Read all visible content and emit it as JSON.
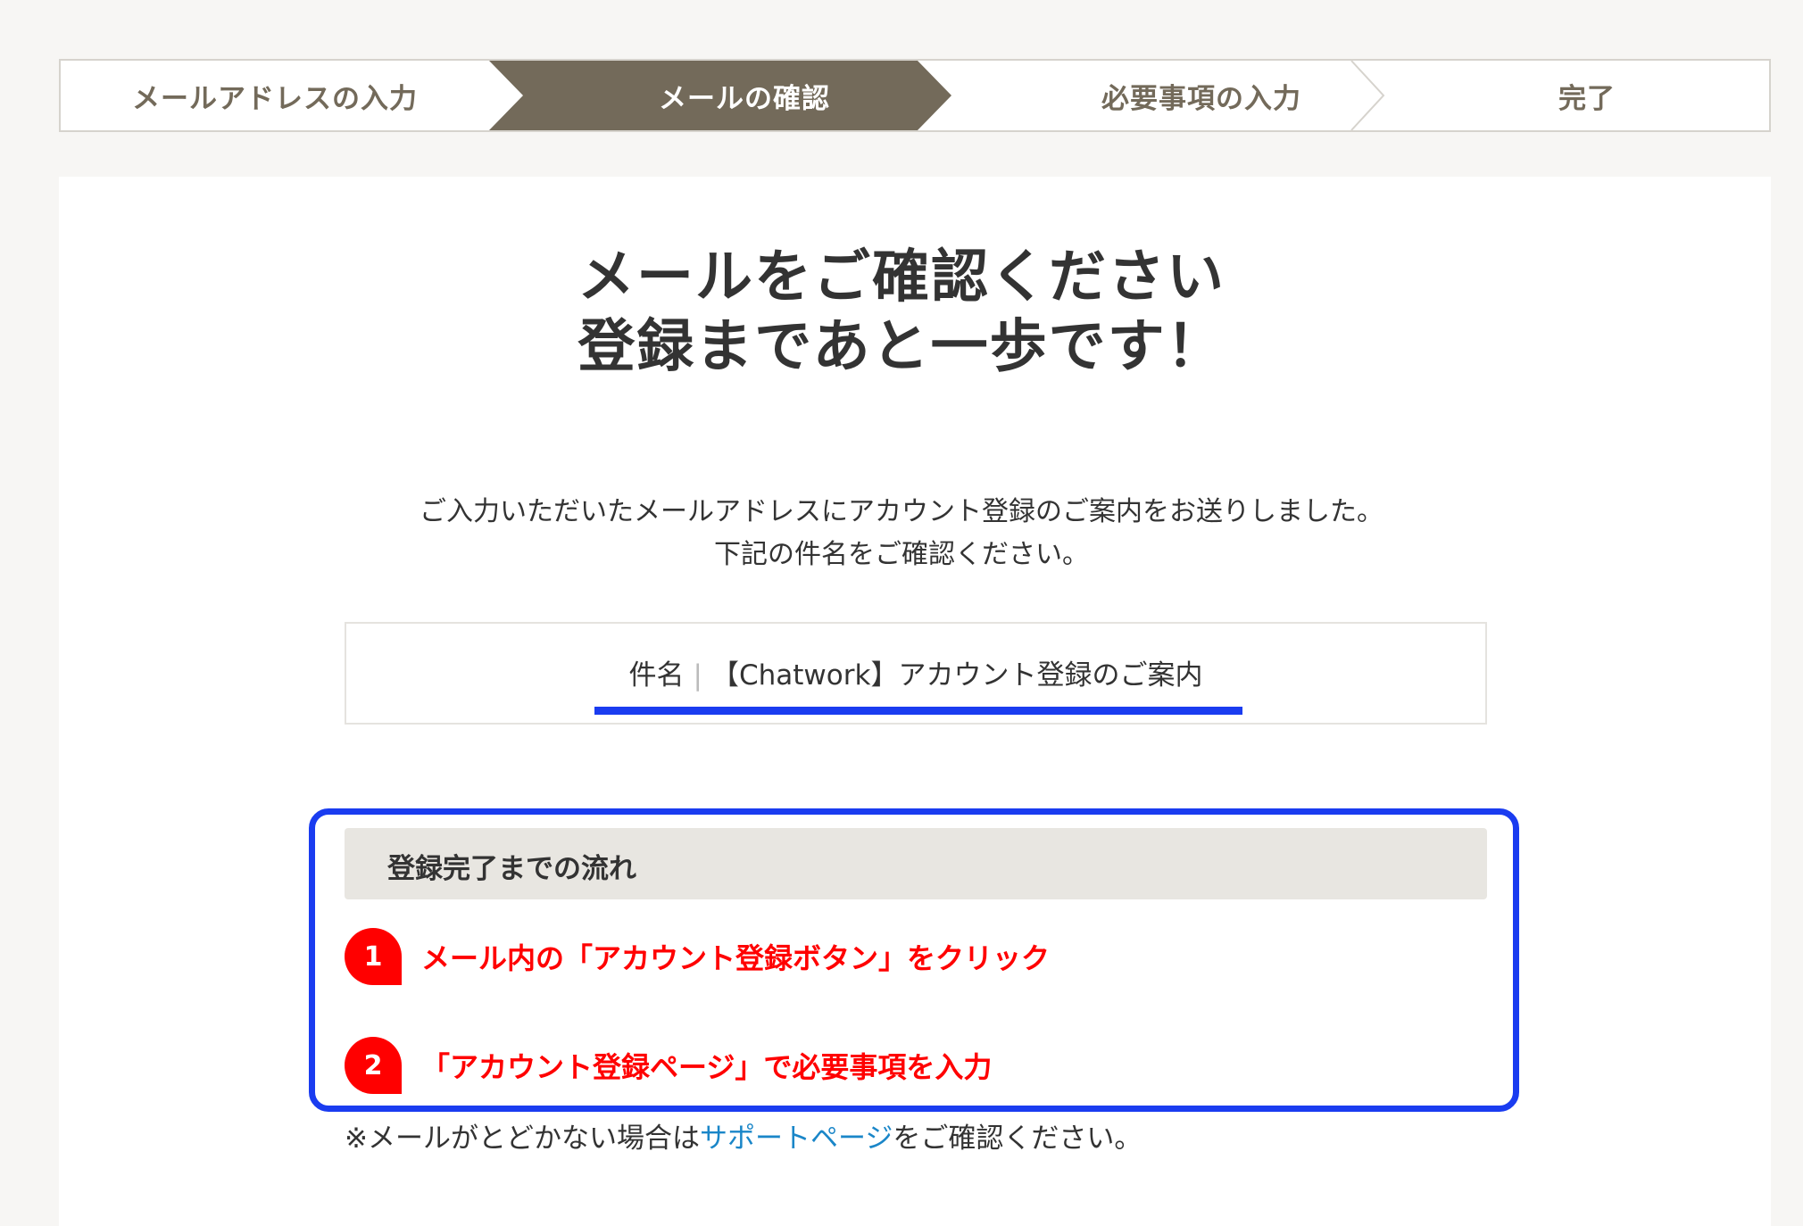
{
  "stepper": {
    "steps": [
      {
        "label": "メールアドレスの入力",
        "state": "done"
      },
      {
        "label": "メールの確認",
        "state": "active"
      },
      {
        "label": "必要事項の入力",
        "state": "pending"
      },
      {
        "label": "完了",
        "state": "pending"
      }
    ]
  },
  "main": {
    "title_line1": "メールをご確認ください",
    "title_line2": "登録まであと一歩です！",
    "lead_line1": "ご入力いただいたメールアドレスにアカウント登録のご案内をお送りしました。",
    "lead_line2": "下記の件名をご確認ください。",
    "subject_label": "件名",
    "subject_separator": "|",
    "subject_value": "【Chatwork】アカウント登録のご案内"
  },
  "flow": {
    "heading": "登録完了までの流れ",
    "items": [
      {
        "number": "1",
        "text": "メール内の「アカウント登録ボタン」をクリック"
      },
      {
        "number": "2",
        "text": "「アカウント登録ページ」で必要事項を入力"
      }
    ]
  },
  "note": {
    "prefix": "※メールがとどかない場合は",
    "link_text": "サポートページ",
    "suffix": "をご確認ください。"
  },
  "colors": {
    "accent_active_step": "#736a5a",
    "highlight_blue": "#1a3cf0",
    "flow_red": "#ff0000",
    "link_blue": "#1a86c8",
    "page_bg": "#f7f6f4"
  }
}
